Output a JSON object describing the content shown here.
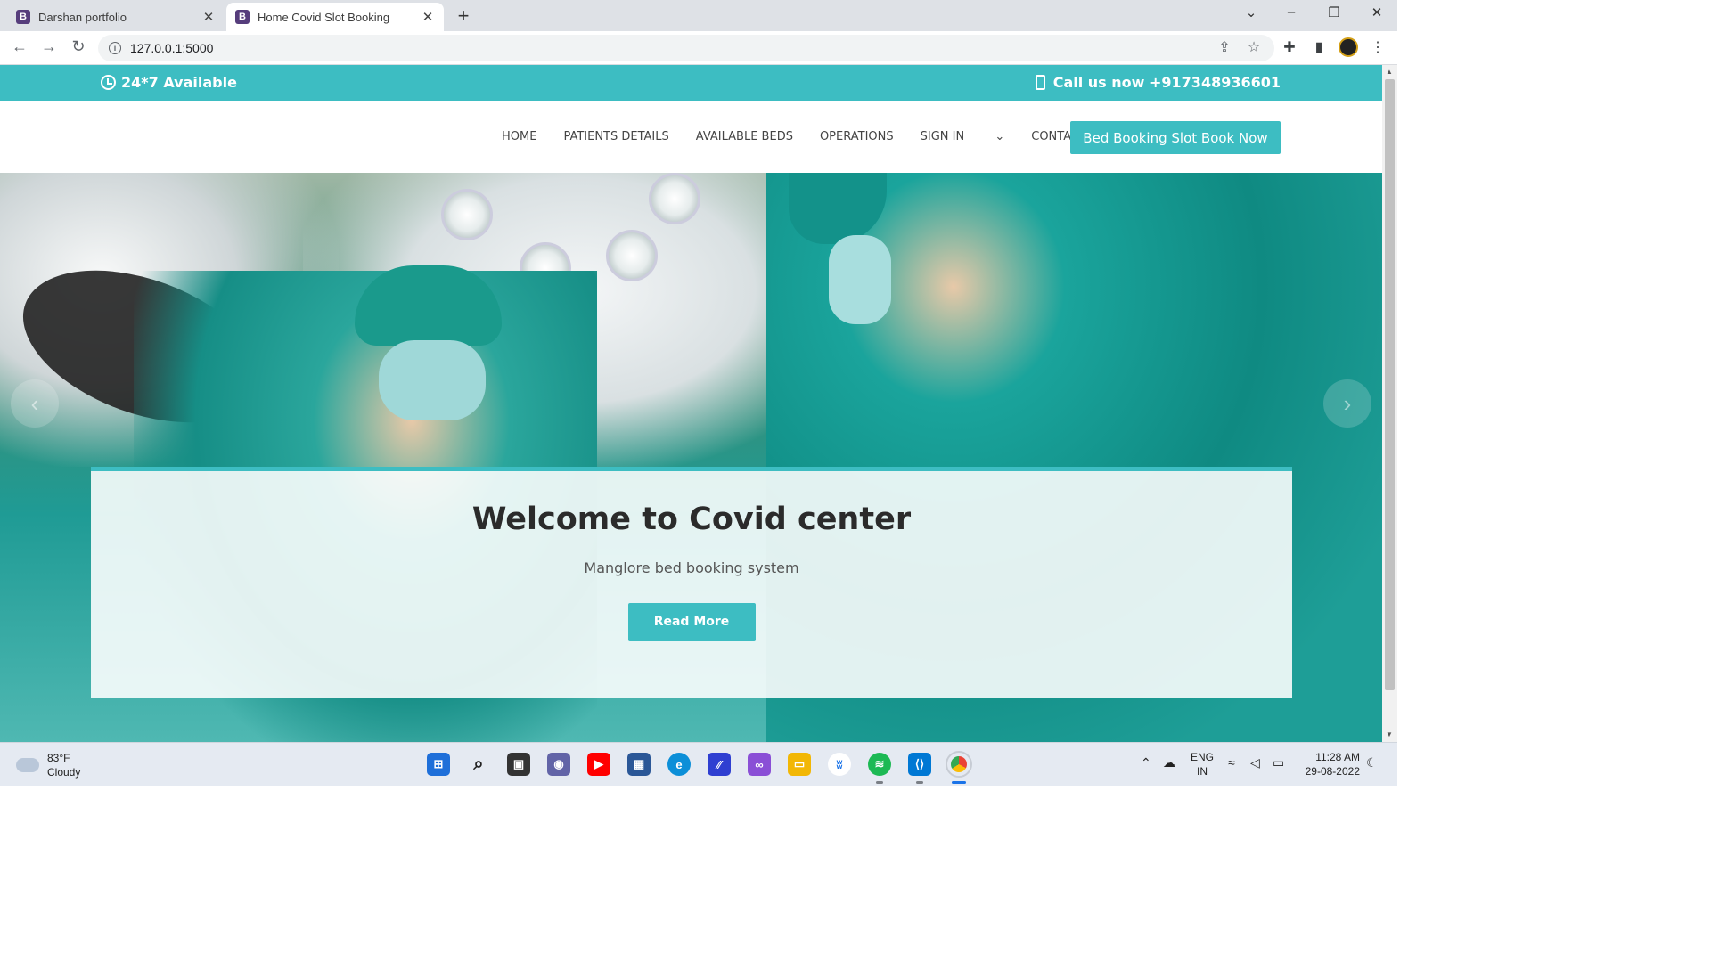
{
  "browser": {
    "tabs": [
      {
        "label": "Darshan portfolio",
        "favicon": "B",
        "active": false
      },
      {
        "label": "Home Covid Slot Booking",
        "favicon": "B",
        "active": true
      }
    ],
    "url": "127.0.0.1:5000"
  },
  "site": {
    "topbar": {
      "availability": "24*7 Available",
      "phone": "Call us now +917348936601"
    },
    "nav": {
      "items": [
        "HOME",
        "PATIENTS DETAILS",
        "AVAILABLE BEDS",
        "OPERATIONS",
        "SIGN IN",
        "CONTACT"
      ],
      "cta": "Bed Booking Slot Book Now"
    },
    "hero": {
      "title": "Welcome to Covid center",
      "subtitle": "Manglore bed booking system",
      "button": "Read More"
    },
    "colors": {
      "accent": "#3dbdc2"
    }
  },
  "taskbar": {
    "weather_temp": "83°F",
    "weather_desc": "Cloudy",
    "lang_top": "ENG",
    "lang_bottom": "IN",
    "time": "11:28 AM",
    "date": "29-08-2022"
  }
}
